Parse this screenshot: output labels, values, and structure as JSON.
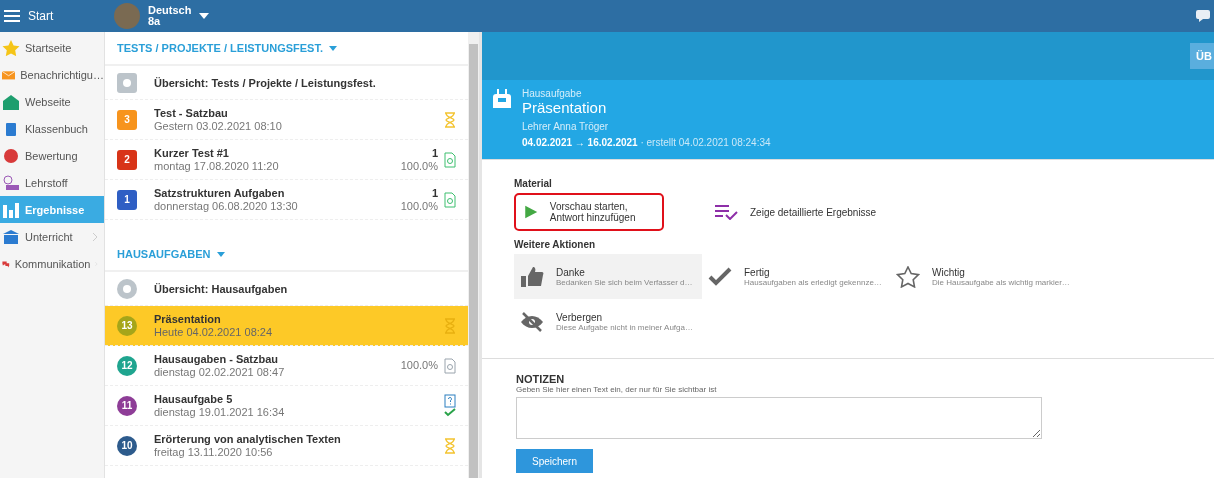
{
  "topbar": {
    "menu_label": "Start",
    "course": "Deutsch",
    "class": "8a"
  },
  "sidebar": {
    "items": [
      {
        "label": "Startseite",
        "selected": false,
        "submenu": false
      },
      {
        "label": "Benachrichtigu…",
        "selected": false,
        "submenu": false
      },
      {
        "label": "Webseite",
        "selected": false,
        "submenu": false
      },
      {
        "label": "Klassenbuch",
        "selected": false,
        "submenu": false
      },
      {
        "label": "Bewertung",
        "selected": false,
        "submenu": false
      },
      {
        "label": "Lehrstoff",
        "selected": false,
        "submenu": false
      },
      {
        "label": "Ergebnisse",
        "selected": true,
        "submenu": false
      },
      {
        "label": "Unterricht",
        "selected": false,
        "submenu": true
      },
      {
        "label": "Kommunikation",
        "selected": false,
        "submenu": true
      }
    ]
  },
  "sections": [
    {
      "title": "TESTS / PROJEKTE / LEISTUNGSFEST.",
      "overview": "Übersicht: Tests / Projekte / Leistungsfest.",
      "items": [
        {
          "badge": "3",
          "color": "#f7941d",
          "title": "Test - Satzbau",
          "date": "Gestern 03.02.2021 08:10",
          "kind": "pending",
          "selected": false
        },
        {
          "badge": "2",
          "color": "#d83418",
          "title": "Kurzer Test #1",
          "date": "montag 17.08.2020 11:20",
          "count": "1",
          "percent": "100.0%",
          "kind": "done",
          "selected": false
        },
        {
          "badge": "1",
          "color": "#2f5fc4",
          "title": "Satzstrukturen Aufgaben",
          "date": "donnerstag 06.08.2020 13:30",
          "count": "1",
          "percent": "100.0%",
          "kind": "done",
          "selected": false
        }
      ]
    },
    {
      "title": "HAUSAUFGABEN",
      "overview": "Übersicht: Hausaufgaben",
      "items": [
        {
          "badge": "13",
          "color": "#a5a51a",
          "title": "Präsentation",
          "date": "Heute 04.02.2021 08:24",
          "kind": "pending",
          "selected": true
        },
        {
          "badge": "12",
          "color": "#1fa58f",
          "title": "Hausaugaben - Satzbau",
          "date": "dienstag 02.02.2021 08:47",
          "percent": "100.0%",
          "kind": "submitted",
          "selected": false
        },
        {
          "badge": "11",
          "color": "#8e3d97",
          "title": "Hausaufgabe 5",
          "date": "dienstag 19.01.2021 16:34",
          "kind": "question",
          "selected": false
        },
        {
          "badge": "10",
          "color": "#2d5b8c",
          "title": "Erörterung von analytischen Texten",
          "date": "freitag 13.11.2020 10:56",
          "kind": "pending",
          "selected": false
        }
      ]
    }
  ],
  "detail": {
    "toolbar_button": "ÜB",
    "type": "Hausaufgabe",
    "title": "Präsentation",
    "teacher": "Lehrer Anna Tröger",
    "period": "04.02.2021 → 16.02.2021",
    "created": " · erstellt 04.02.2021 08:24:34",
    "material_heading": "Material",
    "material": [
      {
        "label": "Vorschau starten, Antwort hinzufügen",
        "highlighted": true
      },
      {
        "label": "Zeige detaillierte Ergebnisse",
        "highlighted": false
      }
    ],
    "actions_heading": "Weitere Aktionen",
    "actions": [
      {
        "title": "Danke",
        "desc": "Bedanken Sie sich beim Verfasser d…",
        "selected": true
      },
      {
        "title": "Fertig",
        "desc": "Hausaufgaben als erledigt gekennze…",
        "selected": false
      },
      {
        "title": "Wichtig",
        "desc": "Die Hausaufgabe als wichtig markier…",
        "selected": false
      },
      {
        "title": "Verbergen",
        "desc": "Diese Aufgabe nicht in meiner Aufga…",
        "selected": false
      }
    ],
    "notes_heading": "NOTIZEN",
    "notes_hint": "Geben Sie hier einen Text ein, der nur für Sie sichtbar ist",
    "save_button": "Speichern"
  }
}
